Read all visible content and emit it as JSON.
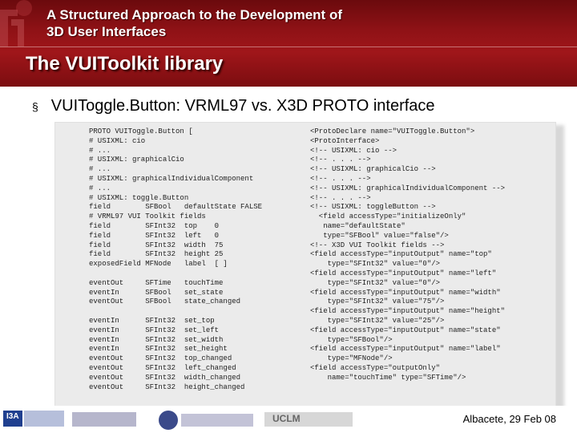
{
  "header": {
    "title": "A Structured Approach to the Development of\n3D User Interfaces",
    "slide_title": "The VUIToolkit library"
  },
  "bullet": {
    "marker": "§",
    "text": "VUIToggle.Button: VRML97 vs. X3D PROTO interface"
  },
  "code_left": "PROTO VUIToggle.Button [\n# USIXML: cio\n# ...\n# USIXML: graphicalCio\n# ...\n# USIXML: graphicalIndividualComponent\n# ...\n# USIXML: toggle.Button\nfield        SFBool   defaultState FALSE\n# VRML97 VUI Toolkit fields\nfield        SFInt32  top    0\nfield        SFInt32  left   0\nfield        SFInt32  width  75\nfield        SFInt32  height 25\nexposedField MFNode   label  [ ]\n\neventOut     SFTime   touchTime\neventIn      SFBool   set_state\neventOut     SFBool   state_changed\n\neventIn      SFInt32  set_top\neventIn      SFInt32  set_left\neventIn      SFInt32  set_width\neventIn      SFInt32  set_height\neventOut     SFInt32  top_changed\neventOut     SFInt32  left_changed\neventOut     SFInt32  width_changed\neventOut     SFInt32  height_changed",
  "code_right": "<ProtoDeclare name=\"VUIToggle.Button\">\n<ProtoInterface>\n<!-- USIXML: cio -->\n<!-- . . . -->\n<!-- USIXML: graphicalCio -->\n<!-- . . . -->\n<!-- USIXML: graphicalIndividualComponent -->\n<!-- . . . -->\n<!-- USIXML: toggleButton -->\n  <field accessType=\"initializeOnly\"\n   name=\"defaultState\"\n   type=\"SFBool\" value=\"false\"/>\n<!-- X3D VUI Toolkit fields -->\n<field accessType=\"inputOutput\" name=\"top\"\n    type=\"SFInt32\" value=\"0\"/>\n<field accessType=\"inputOutput\" name=\"left\"\n    type=\"SFInt32\" value=\"0\"/>\n<field accessType=\"inputOutput\" name=\"width\"\n    type=\"SFInt32\" value=\"75\"/>\n<field accessType=\"inputOutput\" name=\"height\"\n    type=\"SFInt32\" value=\"25\"/>\n<field accessType=\"inputOutput\" name=\"state\"\n    type=\"SFBool\"/>\n<field accessType=\"inputOutput\" name=\"label\"\n    type=\"MFNode\"/>\n<field accessType=\"outputOnly\"\n    name=\"touchTime\" type=\"SFTime\"/>",
  "footer": {
    "logos": [
      "I3A",
      "UCLM"
    ],
    "date": "Albacete, 29 Feb 08"
  },
  "colors": {
    "header": "#8f1216",
    "panel": "#ebebeb"
  }
}
